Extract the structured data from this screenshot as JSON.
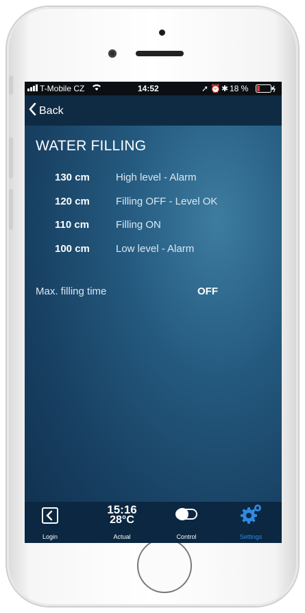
{
  "status_bar": {
    "carrier": "T-Mobile CZ",
    "time": "14:52",
    "battery": "18 %"
  },
  "nav": {
    "back_label": "Back"
  },
  "page": {
    "title": "WATER FILLING",
    "levels": [
      {
        "value": "130 cm",
        "label": "High level - Alarm"
      },
      {
        "value": "120 cm",
        "label": "Filling OFF - Level OK"
      },
      {
        "value": "110 cm",
        "label": "Filling ON"
      },
      {
        "value": "100 cm",
        "label": "Low level - Alarm"
      }
    ],
    "max_filling": {
      "label": "Max. filling time",
      "value": "OFF"
    }
  },
  "tabbar": {
    "login": "Login",
    "actual_time": "15:16",
    "actual_temp": "28°C",
    "actual": "Actual",
    "control": "Control",
    "settings": "Settings"
  },
  "colors": {
    "accent": "#2f8be0",
    "nav_bg": "#0f2b44",
    "screen_bg": "#24597e"
  }
}
